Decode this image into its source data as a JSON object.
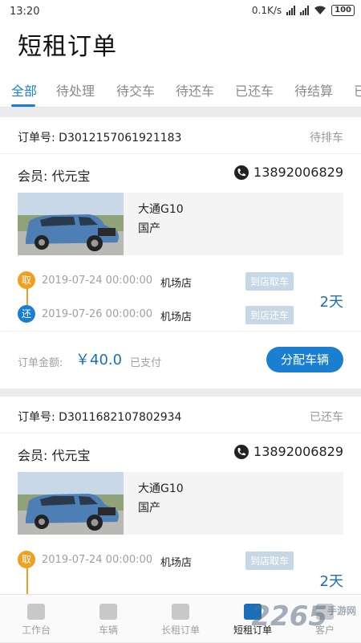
{
  "status_bar": {
    "time": "13:20",
    "speed": "0.1K/s",
    "battery": "100"
  },
  "header": {
    "title": "短租订单"
  },
  "tabs": [
    {
      "label": "全部"
    },
    {
      "label": "待处理"
    },
    {
      "label": "待交车"
    },
    {
      "label": "待还车"
    },
    {
      "label": "已还车"
    },
    {
      "label": "待结算"
    },
    {
      "label": "已"
    }
  ],
  "orders": [
    {
      "order_no": "订单号: D3012157061921183",
      "status": "待排车",
      "member": "会员: 代元宝",
      "phone": "13892006829",
      "car_name": "大通G10",
      "car_origin": "国产",
      "pickup_badge": "取",
      "pickup_date": "2019-07-24 00:00:00",
      "pickup_store": "机场店",
      "pickup_tag": "到店取车",
      "return_badge": "还",
      "return_date": "2019-07-26 00:00:00",
      "return_store": "机场店",
      "return_tag": "到店还车",
      "days": "2天",
      "amount_label": "订单金额:",
      "amount": "￥40.0",
      "pay_status": "已支付",
      "action": "分配车辆"
    },
    {
      "order_no": "订单号: D3011682107802934",
      "status": "已还车",
      "member": "会员: 代元宝",
      "phone": "13892006829",
      "car_name": "大通G10",
      "car_origin": "国产",
      "pickup_badge": "取",
      "pickup_date": "2019-07-24 00:00:00",
      "pickup_store": "机场店",
      "pickup_tag": "到店取车",
      "days": "2天"
    }
  ],
  "bottom_nav": [
    {
      "label": "工作台",
      "icon": "workbench-icon"
    },
    {
      "label": "车辆",
      "icon": "car-icon"
    },
    {
      "label": "长租订单",
      "icon": "long-rent-icon"
    },
    {
      "label": "短租订单",
      "icon": "short-rent-icon"
    },
    {
      "label": "客户",
      "icon": "customer-icon"
    }
  ],
  "watermark": {
    "text": "2265",
    "sub": "手游网"
  },
  "colors": {
    "accent": "#1a7fd1",
    "pickup": "#f0a020"
  }
}
